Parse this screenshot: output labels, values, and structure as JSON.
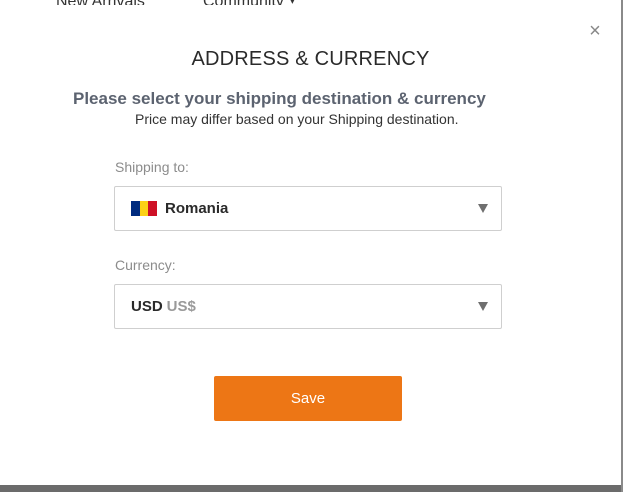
{
  "background_nav": {
    "items": [
      "New Arrivals",
      "Community"
    ]
  },
  "modal": {
    "close_symbol": "×",
    "title": "ADDRESS & CURRENCY",
    "subtitle": "Please select your shipping destination & currency",
    "note": "Price may differ based on your Shipping destination.",
    "shipping": {
      "label": "Shipping to:",
      "selected_country": "Romania",
      "flag_icon": "romania-flag-icon",
      "flag_colors": [
        "#002B7F",
        "#FCD116",
        "#CE1126"
      ]
    },
    "currency": {
      "label": "Currency:",
      "code": "USD",
      "symbol": "US$"
    },
    "save_label": "Save",
    "accent_color": "#ED7615"
  }
}
